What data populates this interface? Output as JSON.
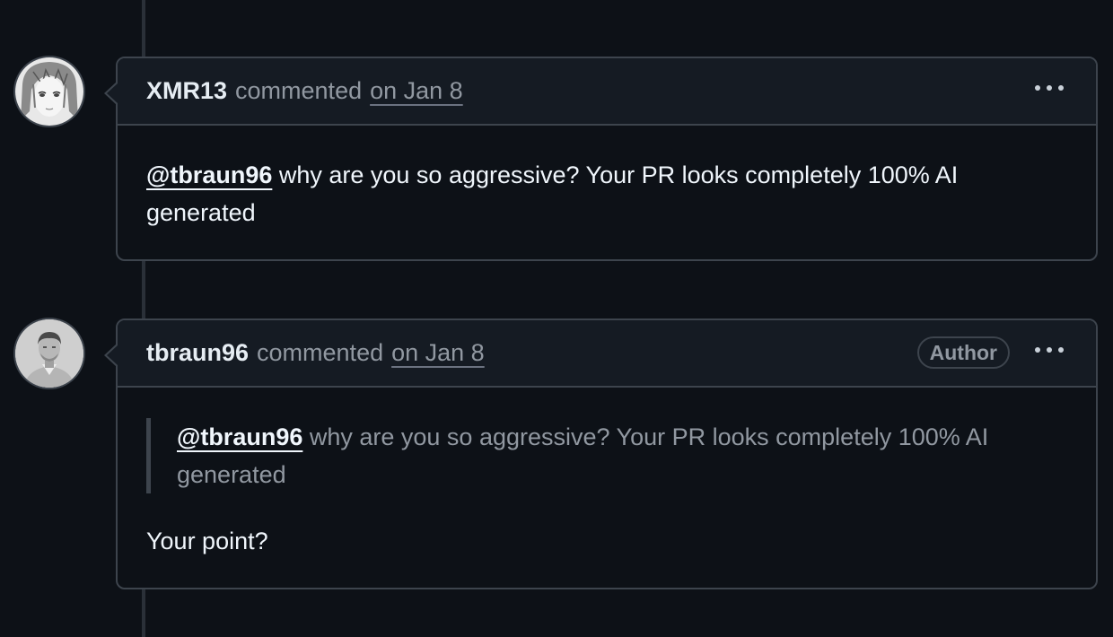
{
  "comments": [
    {
      "author": "XMR13",
      "action": "commented",
      "date": "on Jan 8",
      "avatar_icon": "anime-avatar",
      "body": {
        "mention": "@tbraun96",
        "text": " why are you so aggressive? Your PR looks completely 100% AI generated"
      }
    },
    {
      "author": "tbraun96",
      "action": "commented",
      "date": "on Jan 8",
      "badge": "Author",
      "avatar_icon": "photo-avatar",
      "quote": {
        "mention": "@tbraun96",
        "text": " why are you so aggressive? Your PR looks completely 100% AI generated"
      },
      "body": {
        "text": "Your point?"
      }
    }
  ],
  "menu_icon": "kebab-horizontal-icon",
  "colors": {
    "background": "#0d1117",
    "header_bg": "#151b23",
    "border": "#3d444d",
    "muted_text": "#9198a1",
    "text": "#e6edf3"
  }
}
